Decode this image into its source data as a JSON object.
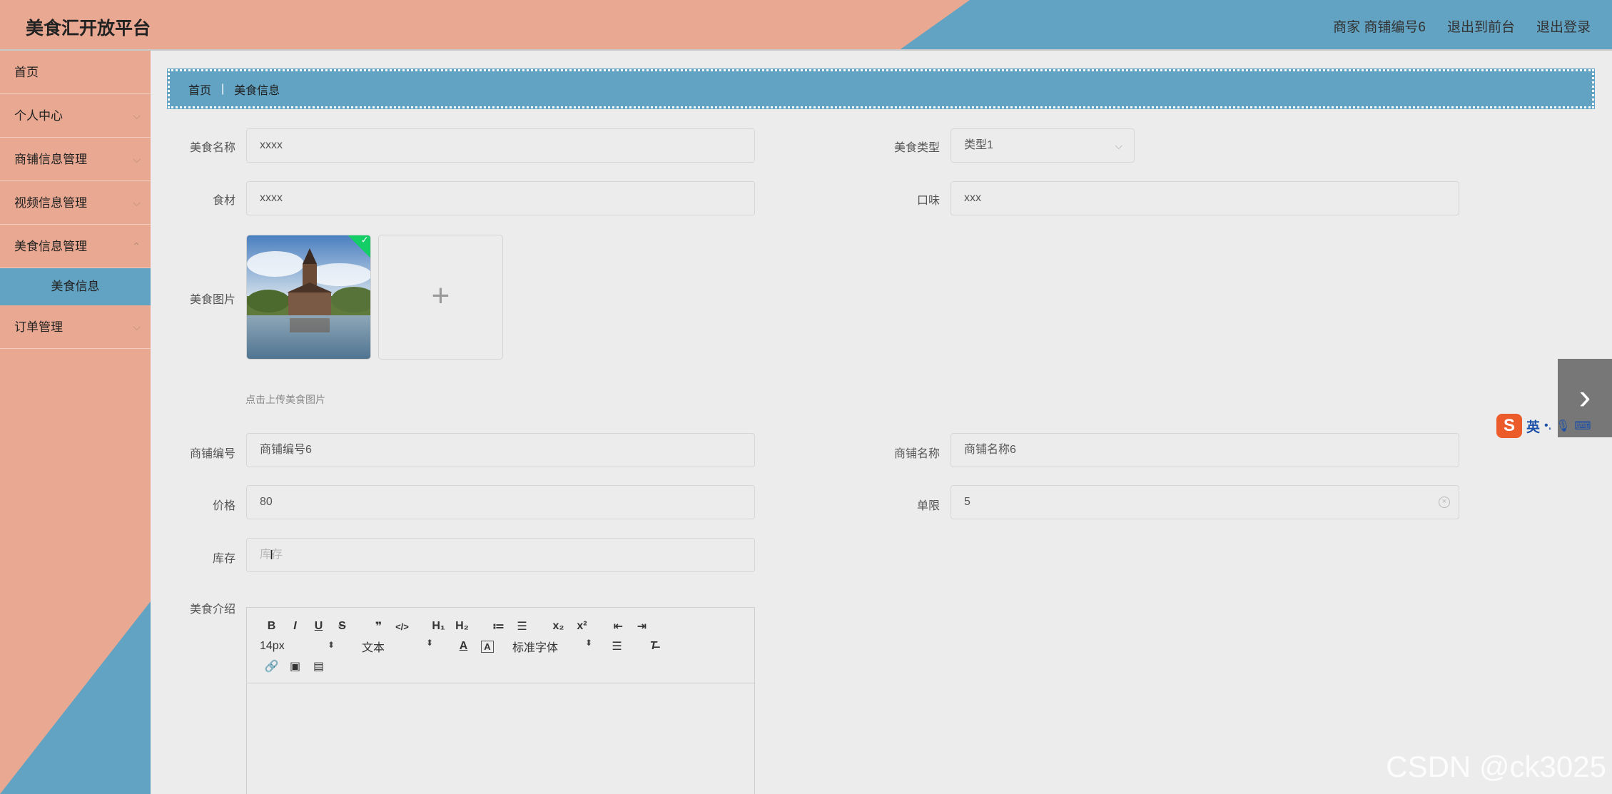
{
  "header": {
    "app_title": "美食汇开放平台",
    "user_info": "商家 商铺编号6",
    "back_to_front": "退出到前台",
    "logout": "退出登录"
  },
  "sidebar": {
    "items": [
      {
        "label": "首页"
      },
      {
        "label": "个人中心"
      },
      {
        "label": "商铺信息管理"
      },
      {
        "label": "视频信息管理"
      },
      {
        "label": "美食信息管理"
      },
      {
        "label": "订单管理"
      }
    ],
    "active_sub": "美食信息"
  },
  "breadcrumb": {
    "home": "首页",
    "sep": "|",
    "current": "美食信息"
  },
  "form": {
    "food_name": {
      "label": "美食名称",
      "value": "xxxx"
    },
    "food_type": {
      "label": "美食类型",
      "value": "类型1"
    },
    "ingredients": {
      "label": "食材",
      "value": "xxxx"
    },
    "taste": {
      "label": "口味",
      "value": "xxx"
    },
    "food_image": {
      "label": "美食图片",
      "hint": "点击上传美食图片",
      "add_symbol": "+"
    },
    "shop_no": {
      "label": "商铺编号",
      "value": "商铺编号6"
    },
    "shop_name": {
      "label": "商铺名称",
      "value": "商铺名称6"
    },
    "price": {
      "label": "价格",
      "value": "80"
    },
    "limit": {
      "label": "单限",
      "value": "5"
    },
    "stock": {
      "label": "库存",
      "placeholder": "库存"
    },
    "intro": {
      "label": "美食介绍"
    }
  },
  "editor": {
    "row1": [
      "B",
      "I",
      "U",
      "S",
      "❞",
      "</>",
      "H₁",
      "H₂",
      "≔",
      "☰",
      "x₂",
      "x²",
      "⇤",
      "⇥"
    ],
    "font_size": "14px",
    "text_type": "文本",
    "font_family": "标准字体",
    "picker_arrow": "⬍"
  },
  "widgets": {
    "next_arrow": "›",
    "ime_logo": "S",
    "ime_lang": "英",
    "watermark": "CSDN @ck3025"
  },
  "colors": {
    "salmon": "#e9a891",
    "blue": "#62a3c3",
    "background": "#ececec"
  }
}
